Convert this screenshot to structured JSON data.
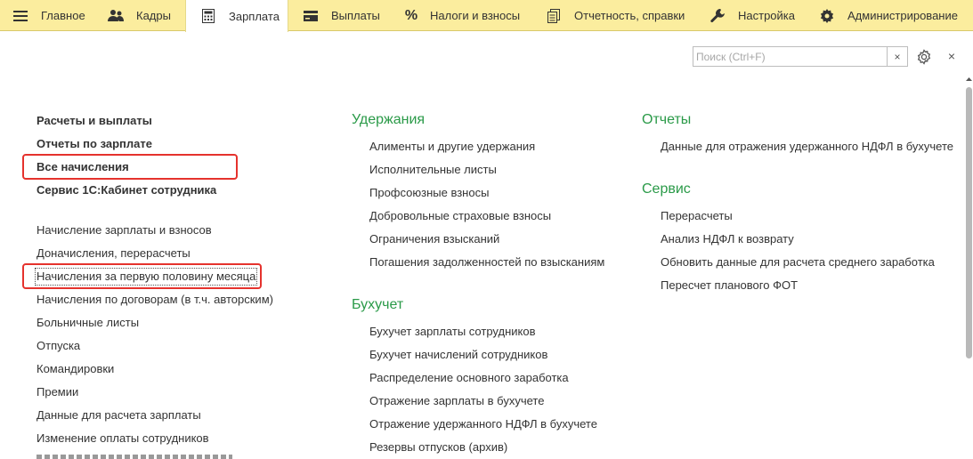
{
  "menu": {
    "items": [
      {
        "label": "Главное",
        "icon": "hamburger-icon"
      },
      {
        "label": "Кадры",
        "icon": "people-icon"
      },
      {
        "label": "Зарплата",
        "icon": "calculator-icon",
        "active": true
      },
      {
        "label": "Выплаты",
        "icon": "wallet-icon"
      },
      {
        "label": "Налоги и взносы",
        "icon": "percent-icon"
      },
      {
        "label": "Отчетность, справки",
        "icon": "documents-icon"
      },
      {
        "label": "Настройка",
        "icon": "wrench-icon"
      },
      {
        "label": "Администрирование",
        "icon": "gear-icon"
      }
    ]
  },
  "toolbar": {
    "search_placeholder": "Поиск (Ctrl+F)",
    "clear_glyph": "×",
    "close_glyph": "×"
  },
  "col1": {
    "bold_items": [
      "Расчеты и выплаты",
      "Отчеты по зарплате",
      "Все начисления",
      "Сервис 1С:Кабинет сотрудника"
    ],
    "items": [
      "Начисление зарплаты и взносов",
      "Доначисления, перерасчеты",
      "Начисления за первую половину месяца",
      "Начисления по договорам (в т.ч. авторским)",
      "Больничные листы",
      "Отпуска",
      "Командировки",
      "Премии",
      "Данные для расчета зарплаты",
      "Изменение оплаты сотрудников"
    ]
  },
  "col2": {
    "uderzhaniya_title": "Удержания",
    "uderzhaniya_items": [
      "Алименты и другие удержания",
      "Исполнительные листы",
      "Профсоюзные взносы",
      "Добровольные страховые взносы",
      "Ограничения взысканий",
      "Погашения задолженностей по взысканиям"
    ],
    "buhuchet_title": "Бухучет",
    "buhuchet_items": [
      "Бухучет зарплаты сотрудников",
      "Бухучет начислений сотрудников",
      "Распределение основного заработка",
      "Отражение зарплаты в бухучете",
      "Отражение удержанного НДФЛ в бухучете",
      "Резервы отпусков (архив)"
    ]
  },
  "col3": {
    "otchety_title": "Отчеты",
    "otchety_items": [
      "Данные для отражения удержанного НДФЛ в бухучете"
    ],
    "servis_title": "Сервис",
    "servis_items": [
      "Перерасчеты",
      "Анализ НДФЛ к возврату",
      "Обновить данные для расчета среднего заработка",
      "Пересчет планового ФОТ"
    ]
  },
  "colors": {
    "menubar": "#fbed9e",
    "section_title": "#2a9a48",
    "highlight": "#e5322d"
  }
}
